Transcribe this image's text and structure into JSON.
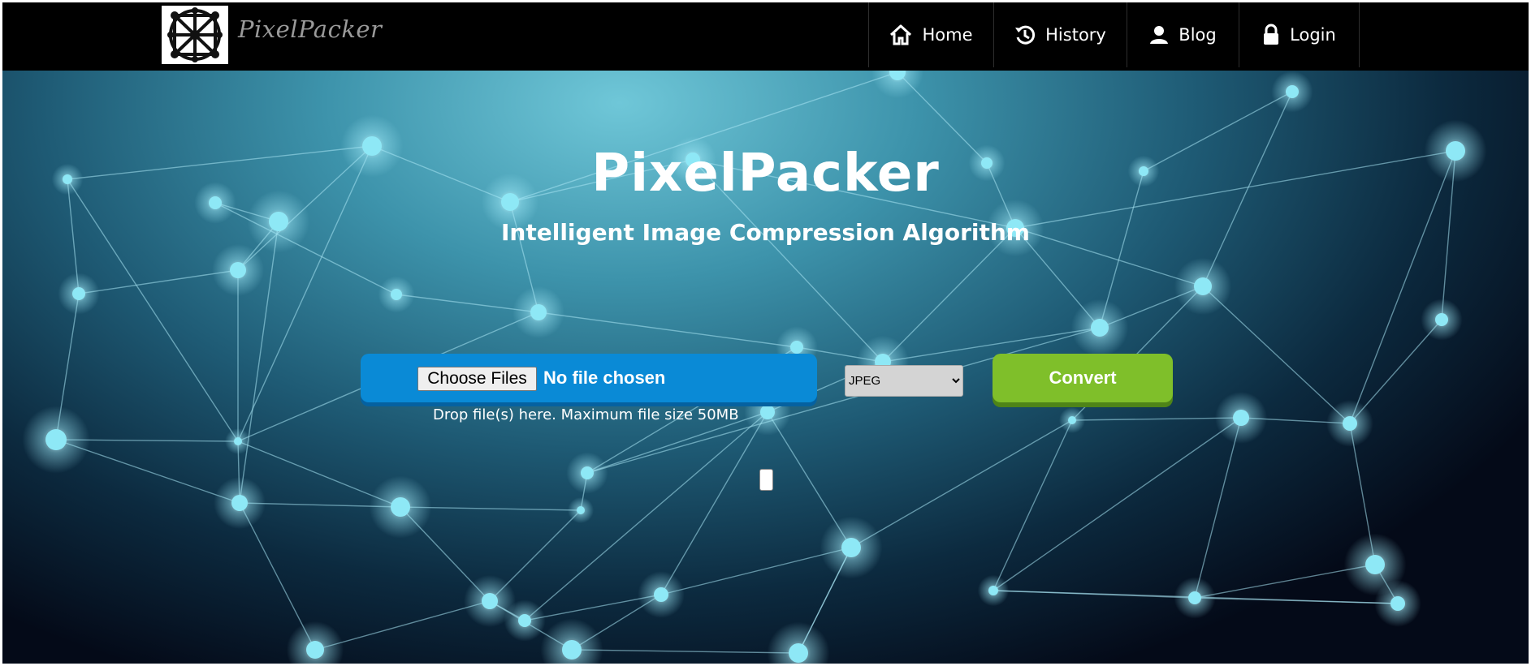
{
  "header": {
    "brand": "PixelPacker",
    "logo_icon": "circuit-grid-logo",
    "nav": [
      {
        "label": "Home",
        "icon": "home-icon"
      },
      {
        "label": "History",
        "icon": "history-icon"
      },
      {
        "label": "Blog",
        "icon": "user-icon"
      },
      {
        "label": "Login",
        "icon": "lock-icon"
      }
    ]
  },
  "hero": {
    "title": "PixelPacker",
    "subtitle": "Intelligent Image Compression Algorithm"
  },
  "upload": {
    "choose_label": "Choose Files",
    "status": "No file chosen",
    "hint": "Drop file(s) here. Maximum file size 50MB"
  },
  "format": {
    "selected": "JPEG"
  },
  "convert_label": "Convert",
  "colors": {
    "nav_bg": "#000000",
    "upload_blue": "#0a8ad6",
    "convert_green": "#7fbf2a",
    "node_cyan": "#8ee8f6"
  }
}
